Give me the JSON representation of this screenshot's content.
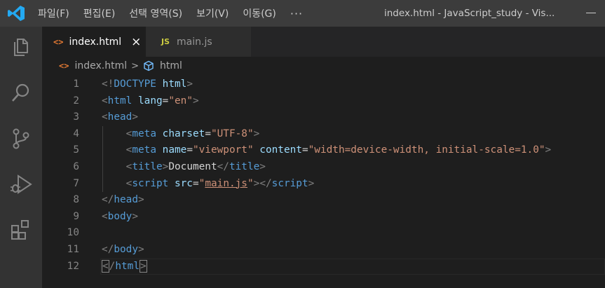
{
  "titlebar": {
    "menus": [
      "파일(F)",
      "편집(E)",
      "선택 영역(S)",
      "보기(V)",
      "이동(G)"
    ],
    "more": "···",
    "window_title": "index.html - JavaScript_study - Vis..."
  },
  "activitybar": {
    "icons": [
      "explorer-icon",
      "search-icon",
      "source-control-icon",
      "run-debug-icon",
      "extensions-icon"
    ]
  },
  "tabs": [
    {
      "icon": "<>",
      "label": "index.html",
      "active": true,
      "close": "×"
    },
    {
      "icon": "JS",
      "label": "main.js",
      "active": false
    }
  ],
  "breadcrumb": {
    "file_icon": "<>",
    "file": "index.html",
    "separator": ">",
    "symbol": "html"
  },
  "editor": {
    "line_numbers": [
      "1",
      "2",
      "3",
      "4",
      "5",
      "6",
      "7",
      "8",
      "9",
      "10",
      "11",
      "12"
    ],
    "lines": [
      {
        "indent": "",
        "tokens": [
          [
            "p",
            "<!"
          ],
          [
            "t",
            "DOCTYPE"
          ],
          [
            "x",
            " "
          ],
          [
            "a",
            "html"
          ],
          [
            "p",
            ">"
          ]
        ]
      },
      {
        "indent": "",
        "tokens": [
          [
            "p",
            "<"
          ],
          [
            "t",
            "html"
          ],
          [
            "x",
            " "
          ],
          [
            "a",
            "lang"
          ],
          [
            "x",
            "="
          ],
          [
            "s",
            "\"en\""
          ],
          [
            "p",
            ">"
          ]
        ]
      },
      {
        "indent": "",
        "tokens": [
          [
            "p",
            "<"
          ],
          [
            "t",
            "head"
          ],
          [
            "p",
            ">"
          ]
        ]
      },
      {
        "indent": "    ",
        "tokens": [
          [
            "p",
            "<"
          ],
          [
            "t",
            "meta"
          ],
          [
            "x",
            " "
          ],
          [
            "a",
            "charset"
          ],
          [
            "x",
            "="
          ],
          [
            "s",
            "\"UTF-8\""
          ],
          [
            "p",
            ">"
          ]
        ]
      },
      {
        "indent": "    ",
        "tokens": [
          [
            "p",
            "<"
          ],
          [
            "t",
            "meta"
          ],
          [
            "x",
            " "
          ],
          [
            "a",
            "name"
          ],
          [
            "x",
            "="
          ],
          [
            "s",
            "\"viewport\""
          ],
          [
            "x",
            " "
          ],
          [
            "a",
            "content"
          ],
          [
            "x",
            "="
          ],
          [
            "s",
            "\"width=device-width, initial-scale=1.0\""
          ],
          [
            "p",
            ">"
          ]
        ]
      },
      {
        "indent": "    ",
        "tokens": [
          [
            "p",
            "<"
          ],
          [
            "t",
            "title"
          ],
          [
            "p",
            ">"
          ],
          [
            "x",
            "Document"
          ],
          [
            "p",
            "</"
          ],
          [
            "t",
            "title"
          ],
          [
            "p",
            ">"
          ]
        ]
      },
      {
        "indent": "    ",
        "tokens": [
          [
            "p",
            "<"
          ],
          [
            "t",
            "script"
          ],
          [
            "x",
            " "
          ],
          [
            "a",
            "src"
          ],
          [
            "x",
            "="
          ],
          [
            "s",
            "\""
          ],
          [
            "u",
            "main.js"
          ],
          [
            "s",
            "\""
          ],
          [
            "p",
            "></"
          ],
          [
            "t",
            "script"
          ],
          [
            "p",
            ">"
          ]
        ]
      },
      {
        "indent": "",
        "tokens": [
          [
            "p",
            "</"
          ],
          [
            "t",
            "head"
          ],
          [
            "p",
            ">"
          ]
        ]
      },
      {
        "indent": "",
        "tokens": [
          [
            "p",
            "<"
          ],
          [
            "t",
            "body"
          ],
          [
            "p",
            ">"
          ]
        ]
      },
      {
        "indent": "",
        "tokens": []
      },
      {
        "indent": "",
        "tokens": [
          [
            "p",
            "</"
          ],
          [
            "t",
            "body"
          ],
          [
            "p",
            ">"
          ]
        ]
      },
      {
        "indent": "",
        "tokens": [
          [
            "b",
            "<"
          ],
          [
            "p",
            "/"
          ],
          [
            "t",
            "html"
          ],
          [
            "b",
            ">"
          ]
        ]
      }
    ]
  },
  "colors": {
    "editor_bg": "#1e1e1e",
    "titlebar_bg": "#3c3c3c",
    "activitybar_bg": "#333333",
    "tag": "#569cd6",
    "attribute": "#9cdcfe",
    "string": "#ce9178",
    "punctuation": "#808080",
    "html_icon": "#e37933",
    "js_icon": "#cbcb41",
    "vscode_blue": "#23a9f2"
  }
}
